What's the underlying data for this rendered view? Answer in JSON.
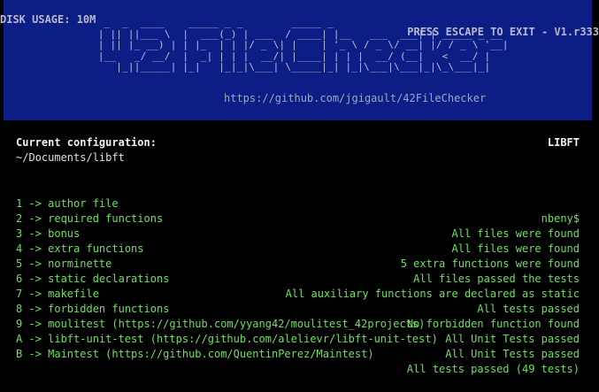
{
  "topbar": {
    "disk_usage": "DISK USAGE: 10M",
    "exit_hint": "PRESS ESCAPE TO EXIT - V1.r333"
  },
  "banner": {
    "ascii_logo": "  _  _  ____    _____ _ _        _____ _               _\n | || ||___ \\  |  ___(_) | ___  / ____| |__   ___  ___| | _____ _ __\n | || |_ __) | | |_  | | |/ _ \\| |    | '_ \\ / _ \\/ __| |/ / _ \\ '__|\n |__   _/ __/  |  _| | | |  __/| |____| | | |  __/ (__|   <  __/ |\n    |_||_____| |_|   |_|_|\\___| \\_____|_| |_|\\___|\\___|_|\\_\\___|_|",
    "repo_url": "https://github.com/jgigault/42FileChecker"
  },
  "config": {
    "title": "Current configuration:",
    "name": "LIBFT",
    "path": "~/Documents/libft"
  },
  "menu": [
    {
      "label": "1 -> author file",
      "status": "nbeny$"
    },
    {
      "label": "2 -> required functions",
      "status": "All files were found"
    },
    {
      "label": "3 -> bonus",
      "status": "All files were found"
    },
    {
      "label": "4 -> extra functions",
      "status": "5 extra functions were found"
    },
    {
      "label": "5 -> norminette",
      "status": "All files passed the tests"
    },
    {
      "label": "6 -> static declarations",
      "status": "All auxiliary functions are declared as static"
    },
    {
      "label": "7 -> makefile",
      "status": "All tests passed"
    },
    {
      "label": "8 -> forbidden functions",
      "status": "No forbidden function found"
    },
    {
      "label": "9 -> moulitest (https://github.com/yyang42/moulitest_42projects)",
      "status": "All Unit Tests passed"
    },
    {
      "label": "A -> libft-unit-test (https://github.com/alelievr/libft-unit-test)",
      "status": "All Unit Tests passed"
    },
    {
      "label": "B -> Maintest (https://github.com/QuentinPerez/Maintest)",
      "status": "All tests passed (49 tests)"
    }
  ],
  "colors": {
    "banner_bg": "#0c1d86",
    "menu_text": "#6ee05c",
    "background": "#000000"
  }
}
